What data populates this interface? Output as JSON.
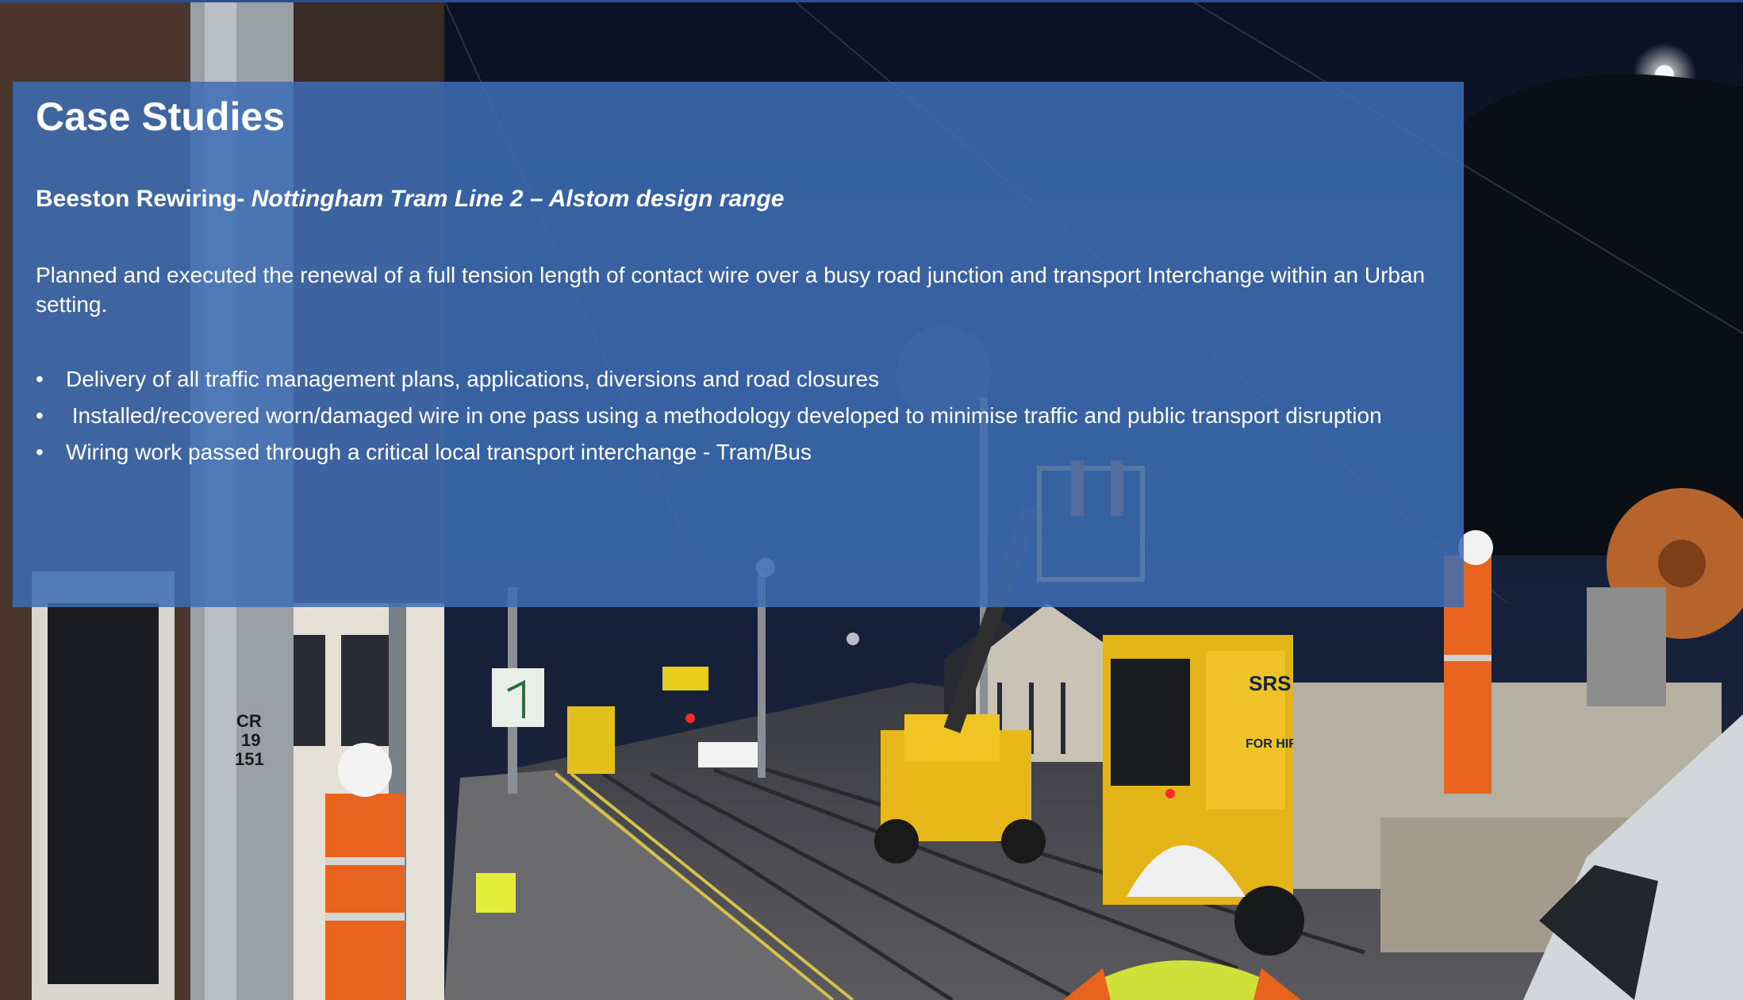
{
  "slide": {
    "title": "Case Studies",
    "subtitle_bold": "Beeston Rewiring- ",
    "subtitle_italic": "Nottingham Tram Line 2 – Alstom design range",
    "description": "Planned and executed the renewal of a full tension length of contact wire over a busy road junction and transport Interchange within an Urban setting.",
    "bullet_char": "•",
    "bullets": [
      "Delivery of all traffic management plans, applications, diversions and road closures",
      " Installed/recovered worn/damaged wire in one pass using a methodology developed to minimise traffic and public transport disruption",
      "Wiring work passed through a critical local transport interchange - Tram/Bus"
    ]
  },
  "photo": {
    "sign_text": [
      "CR",
      "19",
      "151"
    ],
    "truck_logo": "SRS",
    "truck_label": "FOR HIRE"
  },
  "colors": {
    "panel": "#3e6eb4",
    "night_sky": "#0b1428",
    "hi_vis_orange": "#e8641e",
    "machine_yellow": "#f2c200"
  }
}
